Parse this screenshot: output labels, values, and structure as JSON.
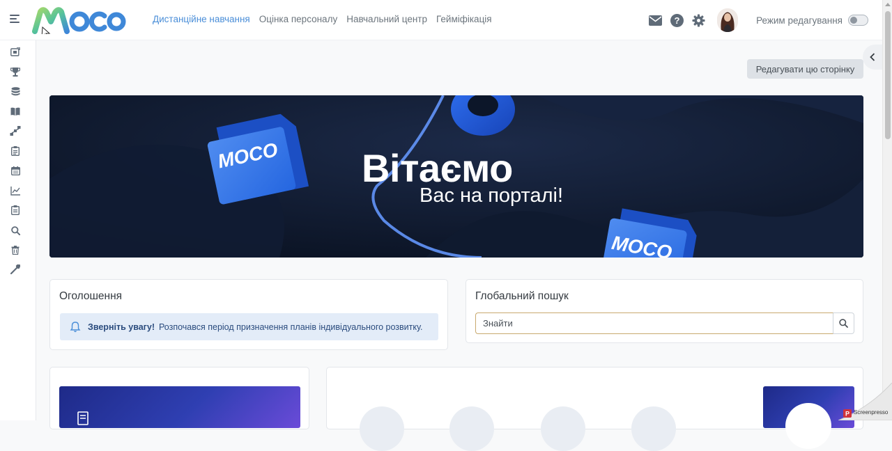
{
  "navbar": {
    "logo_text": "MOCO",
    "links": [
      {
        "label": "Дистанційне навчання",
        "active": true
      },
      {
        "label": "Оцінка персоналу",
        "active": false
      },
      {
        "label": "Навчальний центр",
        "active": false
      },
      {
        "label": "Гейміфікація",
        "active": false
      }
    ],
    "icons": [
      "mail-icon",
      "help-icon",
      "settings-icon"
    ],
    "edit_mode_label": "Режим редагування",
    "edit_mode_on": false
  },
  "sidebar": {
    "icons": [
      "courses-icon",
      "trophy-icon",
      "database-icon",
      "book-icon",
      "hierarchy-icon",
      "clipboard-icon",
      "calendar-icon",
      "chart-icon",
      "report-icon",
      "search-icon",
      "trash-icon",
      "wrench-icon"
    ]
  },
  "page": {
    "edit_page_button": "Редагувати цю сторінку"
  },
  "banner": {
    "title": "Вітаємо",
    "subtitle": "Вас на порталі!",
    "cube_text": "MOCO"
  },
  "announcements": {
    "title": "Оголошення",
    "alert_bold": "Зверніть увагу!",
    "alert_text": "Розпочався період призначення планів індивідуального розвитку."
  },
  "global_search": {
    "title": "Глобальний пошук",
    "placeholder": "Знайти"
  },
  "watermark_text": "Screenpresso",
  "colors": {
    "accent": "#4a8ed8",
    "banner_bg": "#0c1629",
    "alert_bg": "#e3ecf8",
    "tile_blue": "#2f3fb2"
  }
}
